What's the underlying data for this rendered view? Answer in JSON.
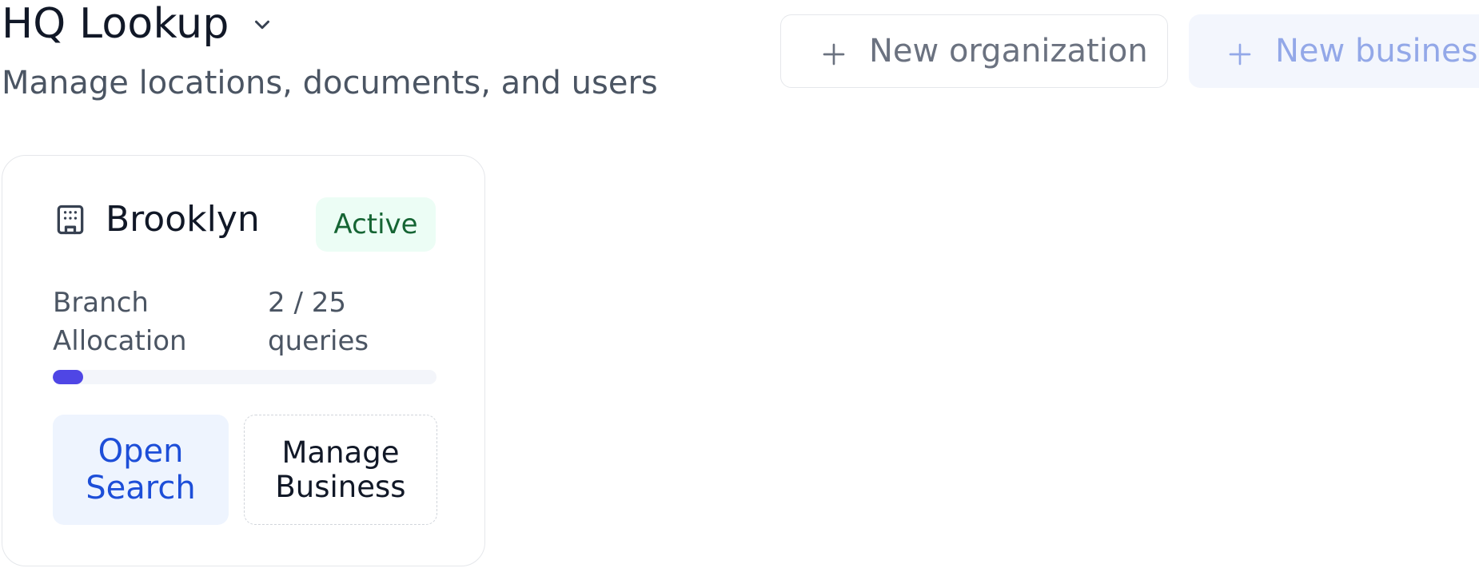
{
  "header": {
    "title": "HQ Lookup",
    "title_icon": "chevron-down-icon",
    "subtitle": "Manage locations, documents, and users"
  },
  "actions": {
    "new_organization_label": "New organization",
    "new_business_label": "New business",
    "plus_icon": "plus-icon"
  },
  "card": {
    "icon": "building-icon",
    "name": "Brooklyn",
    "status": "Active",
    "allocation_label": "Branch Allocation",
    "allocation_value": "2 / 25 queries",
    "allocation_used": 2,
    "allocation_total": 25,
    "open_search_label": "Open Search",
    "manage_business_label": "Manage Business"
  },
  "colors": {
    "accent": "#4f46e5",
    "link": "#1d4ed8",
    "status_bg": "#ecfdf5",
    "status_text": "#166534"
  }
}
